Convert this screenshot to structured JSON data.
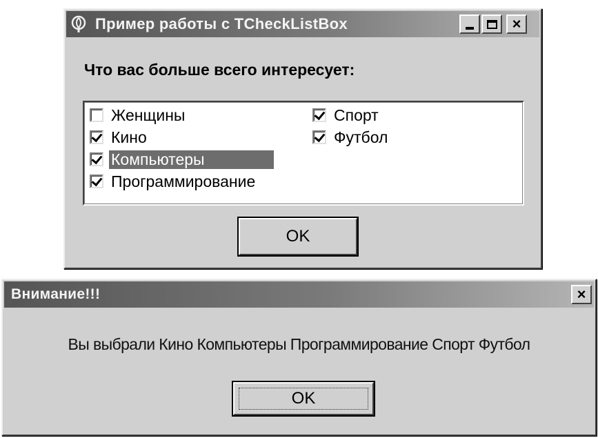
{
  "main_window": {
    "title": "Пример работы с TCheckListBox",
    "question": "Что вас больше всего интересует:",
    "caption_buttons": {
      "minimize_icon": "minimize-icon",
      "maximize_icon": "maximize-icon",
      "close_label": "×"
    },
    "checklist": {
      "items": [
        {
          "label": "Женщины",
          "checked": false,
          "selected": false
        },
        {
          "label": "Кино",
          "checked": true,
          "selected": false
        },
        {
          "label": "Компьютеры",
          "checked": true,
          "selected": true
        },
        {
          "label": "Программирование",
          "checked": true,
          "selected": false
        },
        {
          "label": "Спорт",
          "checked": true,
          "selected": false
        },
        {
          "label": "Футбол",
          "checked": true,
          "selected": false
        }
      ]
    },
    "ok_label": "OK"
  },
  "message_window": {
    "title": "Внимание!!!",
    "close_label": "×",
    "message": "Вы выбрали Кино Компьютеры Программирование Спорт Футбол",
    "ok_label": "OK"
  },
  "colors": {
    "face": "#d4d0c8",
    "title_dark": "#555555",
    "selection": "#6d6d6d"
  }
}
